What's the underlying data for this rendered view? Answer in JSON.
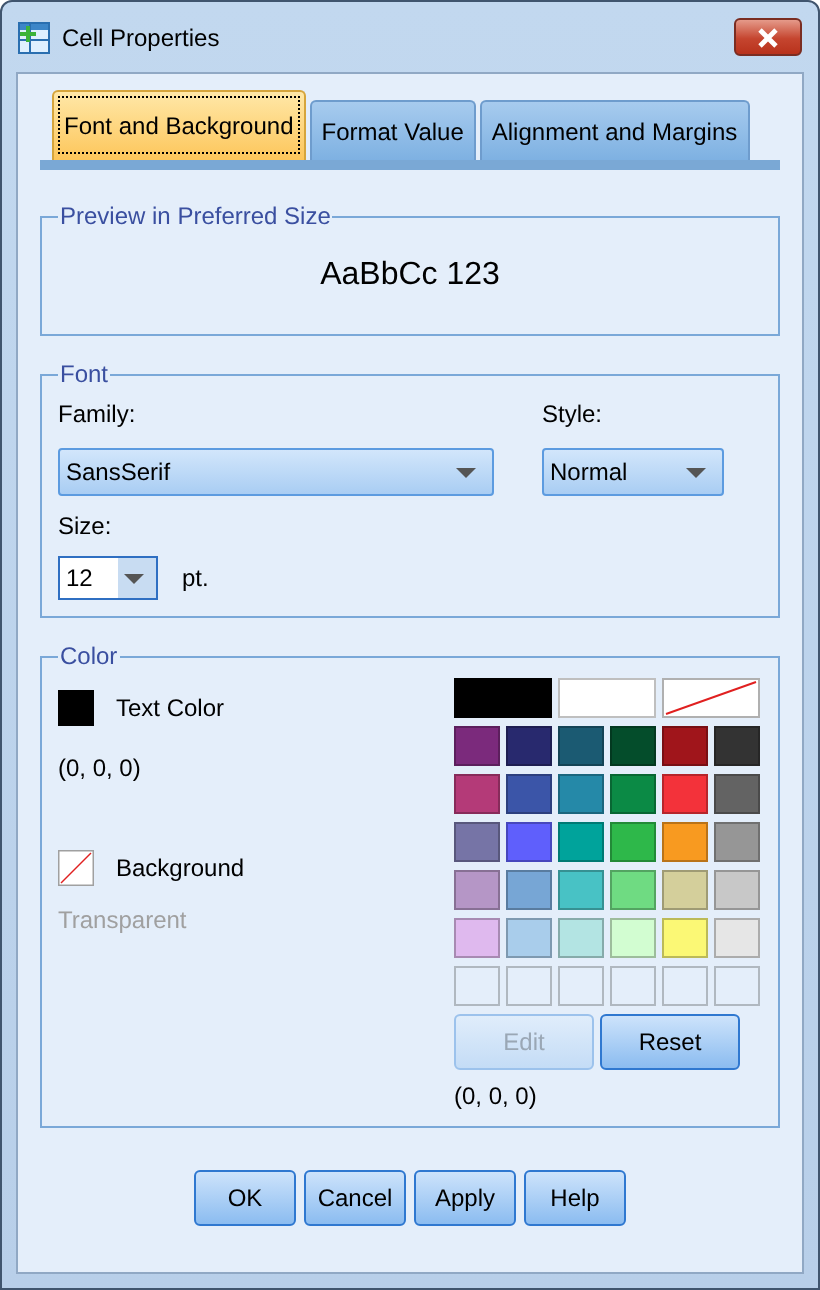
{
  "window": {
    "title": "Cell Properties"
  },
  "tabs": [
    {
      "label": "Font and Background",
      "selected": true
    },
    {
      "label": "Format Value",
      "selected": false
    },
    {
      "label": "Alignment and Margins",
      "selected": false
    }
  ],
  "preview": {
    "title": "Preview in Preferred Size",
    "sample": "AaBbCc 123"
  },
  "font": {
    "title": "Font",
    "family_label": "Family:",
    "family": "SansSerif",
    "style_label": "Style:",
    "style": "Normal",
    "size_label": "Size:",
    "size": "12",
    "size_unit": "pt."
  },
  "color": {
    "title": "Color",
    "text_color_label": "Text Color",
    "text_swatch": {
      "color": "#000000"
    },
    "text_color_value": "(0, 0, 0)",
    "background_label": "Background",
    "background_value": "Transparent",
    "swatches": [
      {
        "kind": "wide",
        "color": "#000000"
      },
      {
        "kind": "wide",
        "color": "#ffffff"
      },
      {
        "kind": "none"
      },
      {
        "kind": "color",
        "color": "#7b2a7c"
      },
      {
        "kind": "color",
        "color": "#28296e"
      },
      {
        "kind": "color",
        "color": "#1b5a72"
      },
      {
        "kind": "color",
        "color": "#044d2b"
      },
      {
        "kind": "color",
        "color": "#a0151b"
      },
      {
        "kind": "color",
        "color": "#333333"
      },
      {
        "kind": "color",
        "color": "#b43a78"
      },
      {
        "kind": "color",
        "color": "#3b55a8"
      },
      {
        "kind": "color",
        "color": "#2589a8"
      },
      {
        "kind": "color",
        "color": "#0b8a45"
      },
      {
        "kind": "color",
        "color": "#f3323a"
      },
      {
        "kind": "color",
        "color": "#636363"
      },
      {
        "kind": "color",
        "color": "#7674a6"
      },
      {
        "kind": "color",
        "color": "#5f5ffc"
      },
      {
        "kind": "color",
        "color": "#00a39b"
      },
      {
        "kind": "color",
        "color": "#2eb84a"
      },
      {
        "kind": "color",
        "color": "#f89a20"
      },
      {
        "kind": "color",
        "color": "#969696"
      },
      {
        "kind": "color",
        "color": "#b596c6"
      },
      {
        "kind": "color",
        "color": "#77a6d5"
      },
      {
        "kind": "color",
        "color": "#48c2c5"
      },
      {
        "kind": "color",
        "color": "#6fdb82"
      },
      {
        "kind": "color",
        "color": "#d4cf9b"
      },
      {
        "kind": "color",
        "color": "#c8c8c8"
      },
      {
        "kind": "color",
        "color": "#dfb9ee"
      },
      {
        "kind": "color",
        "color": "#a9cdeb"
      },
      {
        "kind": "color",
        "color": "#b3e4e3"
      },
      {
        "kind": "color",
        "color": "#d2fdd1"
      },
      {
        "kind": "color",
        "color": "#fbf875"
      },
      {
        "kind": "color",
        "color": "#e6e6e6"
      },
      {
        "kind": "empty"
      },
      {
        "kind": "empty"
      },
      {
        "kind": "empty"
      },
      {
        "kind": "empty"
      },
      {
        "kind": "empty"
      },
      {
        "kind": "empty"
      }
    ],
    "edit_button": {
      "label": "Edit",
      "disabled": true
    },
    "reset_button": {
      "label": "Reset",
      "disabled": false
    },
    "selected_value": "(0, 0, 0)"
  },
  "buttons": [
    "OK",
    "Cancel",
    "Apply",
    "Help"
  ]
}
